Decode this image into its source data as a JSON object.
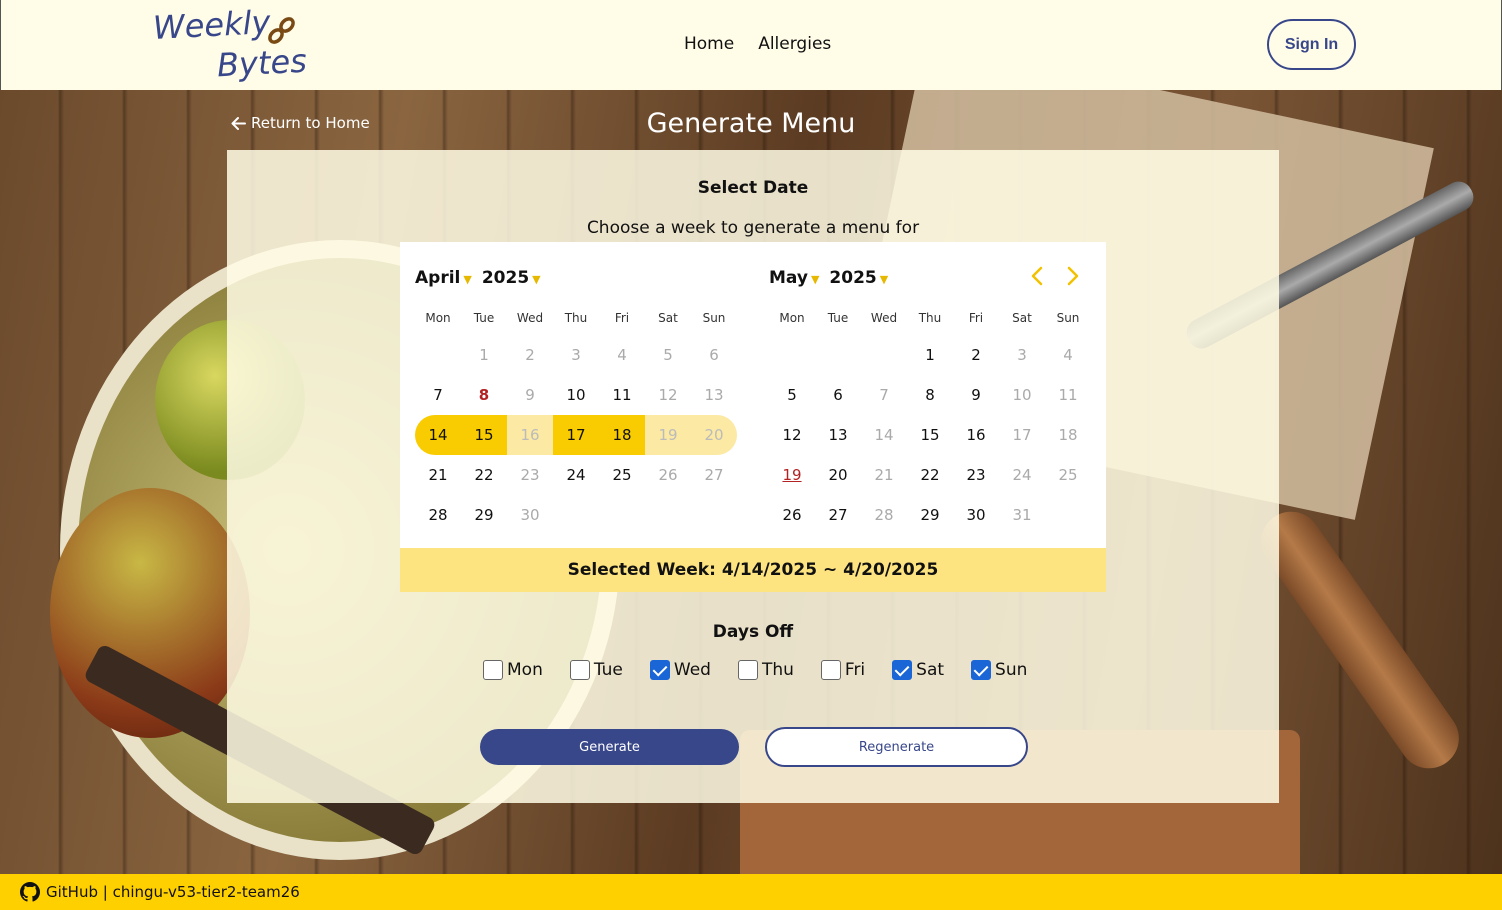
{
  "header": {
    "logo_line1": "Weekly",
    "logo_line2": "Bytes",
    "nav": [
      "Home",
      "Allergies"
    ],
    "signin": "Sign In"
  },
  "page": {
    "return_label": "Return to Home",
    "title": "Generate Menu",
    "select_date": "Select Date",
    "choose_text": "Choose a week to generate a menu for"
  },
  "calendar": {
    "weekdays": [
      "Mon",
      "Tue",
      "Wed",
      "Thu",
      "Fri",
      "Sat",
      "Sun"
    ],
    "left": {
      "month": "April",
      "year": "2025",
      "cells": [
        [
          "",
          ""
        ],
        [
          "1",
          "dim"
        ],
        [
          "2",
          "dim"
        ],
        [
          "3",
          "dim"
        ],
        [
          "4",
          "dim"
        ],
        [
          "5",
          "dim"
        ],
        [
          "6",
          "dim"
        ],
        [
          "7",
          ""
        ],
        [
          "8",
          "today"
        ],
        [
          "9",
          "dim"
        ],
        [
          "10",
          ""
        ],
        [
          "11",
          ""
        ],
        [
          "12",
          "dim"
        ],
        [
          "13",
          "dim"
        ],
        [
          "14",
          "sel first"
        ],
        [
          "15",
          "sel"
        ],
        [
          "16",
          "sel-dim"
        ],
        [
          "17",
          "sel"
        ],
        [
          "18",
          "sel"
        ],
        [
          "19",
          "sel-dim"
        ],
        [
          "20",
          "sel-dim last"
        ],
        [
          "21",
          ""
        ],
        [
          "22",
          ""
        ],
        [
          "23",
          "dim"
        ],
        [
          "24",
          ""
        ],
        [
          "25",
          ""
        ],
        [
          "26",
          "dim"
        ],
        [
          "27",
          "dim"
        ],
        [
          "28",
          ""
        ],
        [
          "29",
          ""
        ],
        [
          "30",
          "dim"
        ]
      ]
    },
    "right": {
      "month": "May",
      "year": "2025",
      "cells": [
        [
          "",
          ""
        ],
        [
          "",
          ""
        ],
        [
          "",
          ""
        ],
        [
          "1",
          ""
        ],
        [
          "2",
          ""
        ],
        [
          "3",
          "dim"
        ],
        [
          "4",
          "dim"
        ],
        [
          "5",
          ""
        ],
        [
          "6",
          ""
        ],
        [
          "7",
          "dim"
        ],
        [
          "8",
          ""
        ],
        [
          "9",
          ""
        ],
        [
          "10",
          "dim"
        ],
        [
          "11",
          "dim"
        ],
        [
          "12",
          ""
        ],
        [
          "13",
          ""
        ],
        [
          "14",
          "dim"
        ],
        [
          "15",
          ""
        ],
        [
          "16",
          ""
        ],
        [
          "17",
          "dim"
        ],
        [
          "18",
          "dim"
        ],
        [
          "19",
          "u"
        ],
        [
          "20",
          ""
        ],
        [
          "21",
          "dim"
        ],
        [
          "22",
          ""
        ],
        [
          "23",
          ""
        ],
        [
          "24",
          "dim"
        ],
        [
          "25",
          "dim"
        ],
        [
          "26",
          ""
        ],
        [
          "27",
          ""
        ],
        [
          "28",
          "dim"
        ],
        [
          "29",
          ""
        ],
        [
          "30",
          ""
        ],
        [
          "31",
          "dim"
        ]
      ]
    },
    "selected_week": "Selected Week: 4/14/2025 ~ 4/20/2025"
  },
  "days_off": {
    "title": "Days Off",
    "days": [
      {
        "label": "Mon",
        "checked": false
      },
      {
        "label": "Tue",
        "checked": false
      },
      {
        "label": "Wed",
        "checked": true
      },
      {
        "label": "Thu",
        "checked": false
      },
      {
        "label": "Fri",
        "checked": false
      },
      {
        "label": "Sat",
        "checked": true
      },
      {
        "label": "Sun",
        "checked": true
      }
    ]
  },
  "buttons": {
    "generate": "Generate",
    "regenerate": "Regenerate"
  },
  "footer": {
    "text": "GitHub | chingu-v53-tier2-team26"
  },
  "colors": {
    "brand_blue": "#38478a",
    "accent_yellow": "#f8cc00",
    "footer_yellow": "#ffd000",
    "checkbox_blue": "#1a66d6"
  }
}
